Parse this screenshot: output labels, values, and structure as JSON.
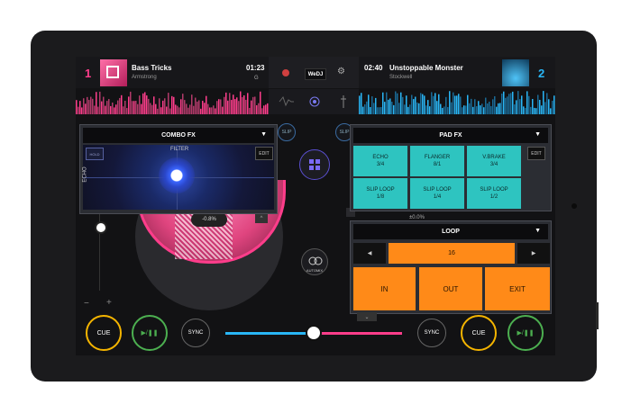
{
  "deck1": {
    "number": "1",
    "title": "Bass Tricks",
    "artist": "Armstrong",
    "time": "01:23",
    "key": "G",
    "bpm_offset": "-0.8%"
  },
  "deck2": {
    "number": "2",
    "title": "Unstoppable Monster",
    "artist": "Stockwell",
    "time": "02:40",
    "bpm_offset": "±0.0%"
  },
  "center": {
    "logo": "WeDJ"
  },
  "slip": {
    "left": "SLIP",
    "right": "SLIP"
  },
  "combo_fx": {
    "title": "COMBO FX",
    "hold": "HOLD",
    "label": "FILTER",
    "axis": "ECHO",
    "edit": "EDIT"
  },
  "pad_fx": {
    "title": "PAD FX",
    "edit": "EDIT",
    "pads": [
      {
        "name": "ECHO",
        "value": "3/4"
      },
      {
        "name": "FLANGER",
        "value": "8/1"
      },
      {
        "name": "V.BRAKE",
        "value": "3/4"
      },
      {
        "name": "SLIP LOOP",
        "value": "1/8"
      },
      {
        "name": "SLIP LOOP",
        "value": "1/4"
      },
      {
        "name": "SLIP LOOP",
        "value": "1/2"
      }
    ]
  },
  "loop": {
    "title": "LOOP",
    "value": "16",
    "in": "IN",
    "out": "OUT",
    "exit": "EXIT"
  },
  "automix": {
    "label": "AUTOMIX"
  },
  "transport": {
    "cue": "CUE",
    "sync": "SYNC"
  },
  "zoom": {
    "minus": "−",
    "plus": "+"
  },
  "crossfader_position": 0.5,
  "colors": {
    "deck1": "#ff3d8b",
    "deck2": "#29b6f6",
    "pad": "#2ec4c0",
    "loop": "#ff8a18",
    "cue": "#f4b400",
    "play": "#4caf50"
  },
  "icons": [
    "record-icon",
    "settings-icon",
    "waveform-icon",
    "target-icon",
    "eq-icon",
    "grid-icon",
    "play-pause-icon",
    "chevron-down-icon",
    "arrow-left-icon",
    "arrow-right-icon"
  ]
}
